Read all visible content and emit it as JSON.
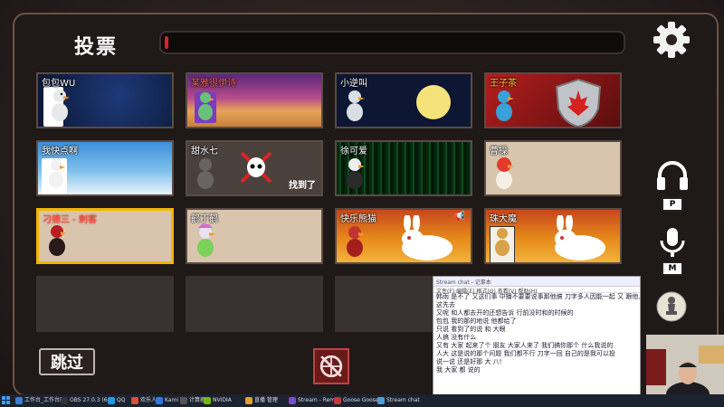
{
  "header": {
    "title": "投票"
  },
  "cards": [
    {
      "name": "包包WU",
      "theme": "space"
    },
    {
      "name": "某雅很伊诗",
      "theme": "desert"
    },
    {
      "name": "小逆叫",
      "theme": "moon"
    },
    {
      "name": "王子茶",
      "theme": "canada"
    },
    {
      "name": "我快点啊",
      "theme": "sky"
    },
    {
      "name": "甜水七",
      "theme": "dead",
      "status": "找到了"
    },
    {
      "name": "徐可爱",
      "theme": "matrix"
    },
    {
      "name": "曹操",
      "theme": "lion"
    },
    {
      "name": "刁德三 - 刺客",
      "theme": "plain",
      "selected": true
    },
    {
      "name": "鹤丁鹤",
      "theme": "plain"
    },
    {
      "name": "快乐熊猫",
      "theme": "rabbit"
    },
    {
      "name": "珠大魔",
      "theme": "rabbit"
    },
    {
      "name": "",
      "theme": "empty"
    },
    {
      "name": "",
      "theme": "empty"
    },
    {
      "name": "",
      "theme": "empty"
    }
  ],
  "side_controls": [
    {
      "icon": "headphones-icon",
      "key": "P"
    },
    {
      "icon": "microphone-icon",
      "key": "M"
    },
    {
      "icon": "chess-pawn-icon",
      "key": ""
    }
  ],
  "footer": {
    "skip_label": "跳过"
  },
  "chat": {
    "title": "Stream chat - 记事本",
    "menu": "文件(F)  编辑(E)  格式(O)  查看(V)  帮助(H)",
    "lines": [
      "韩雨 是不了 又这们事 中播不要要说事那他搞 刀字多人因能一起 又 跟他人投",
      "这先去",
      "又呢 和人都去开的还想告诉 行前没时和的时候的",
      "包包 我的那的地说 他都给了",
      "只说 看到了的说 和 大眼",
      "人搞 没有什么",
      "又有 大家 起来了个 朋友 大家人来了 我们搞你那个 什么我说的",
      "人大 这是说的那个问题 我们都不行 刀字一回 自己的是我可以投",
      "说一说 还是好那 大 八!",
      "我 大家 都 说的"
    ]
  },
  "taskbar": [
    {
      "label": "工作台_工作台面板",
      "color": "#3c7dd9"
    },
    {
      "label": "OBS 27.0.3 (64 bit)",
      "color": "#333333"
    },
    {
      "label": "QQ",
      "color": "#1e9be8"
    },
    {
      "label": "欢乐人 - 鹅鸭杀",
      "color": "#d94f3c"
    },
    {
      "label": "Kami 开发 平台",
      "color": "#2d7be0"
    },
    {
      "label": "计算器",
      "color": "#555555"
    },
    {
      "label": "NVIDIA",
      "color": "#76b900"
    },
    {
      "label": "直播 管理",
      "color": "#e0a030"
    },
    {
      "label": "Stream - Remote",
      "color": "#7b4bd0"
    },
    {
      "label": "Goose Goose Duck",
      "color": "#c23b3b"
    },
    {
      "label": "Stream chat",
      "color": "#4aa0d8"
    }
  ]
}
